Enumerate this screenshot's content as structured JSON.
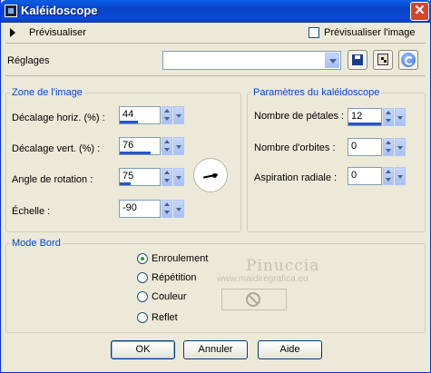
{
  "window": {
    "title": "Kaléidoscope",
    "close_glyph": "✕"
  },
  "preview": {
    "label": "Prévisualiser",
    "checkbox_label": "Prévisualiser l'image",
    "checked": false
  },
  "presets": {
    "label": "Réglages",
    "value": ""
  },
  "zone": {
    "legend": "Zone de l'image",
    "fields": [
      {
        "label": "Décalage horiz. (%) :",
        "value": "44"
      },
      {
        "label": "Décalage vert. (%) :",
        "value": "76"
      },
      {
        "label": "Angle de rotation :",
        "value": "75"
      },
      {
        "label": "Échelle :",
        "value": "-90"
      }
    ]
  },
  "params": {
    "legend": "Paramètres du kaléidoscope",
    "fields": [
      {
        "label": "Nombre de pétales :",
        "value": "12"
      },
      {
        "label": "Nombre d'orbites :",
        "value": "0"
      },
      {
        "label": "Aspiration radiale :",
        "value": "0"
      }
    ]
  },
  "mode": {
    "legend": "Mode Bord",
    "options": [
      {
        "label": "Enroulement",
        "selected": true
      },
      {
        "label": "Répétition",
        "selected": false
      },
      {
        "label": "Couleur",
        "selected": false
      },
      {
        "label": "Reflet",
        "selected": false
      }
    ]
  },
  "watermark": {
    "line1": "Pinuccia",
    "line2": "www.maidiregrafica.eu"
  },
  "buttons": {
    "ok": "OK",
    "cancel": "Annuler",
    "help": "Aide"
  },
  "icons": [
    "app-icon",
    "save-icon",
    "dice-icon",
    "reset-icon",
    "no-entry-icon"
  ],
  "colors": {
    "accent": "#0046d5",
    "titlebar": "#0842c8",
    "background": "#ece9d8"
  }
}
